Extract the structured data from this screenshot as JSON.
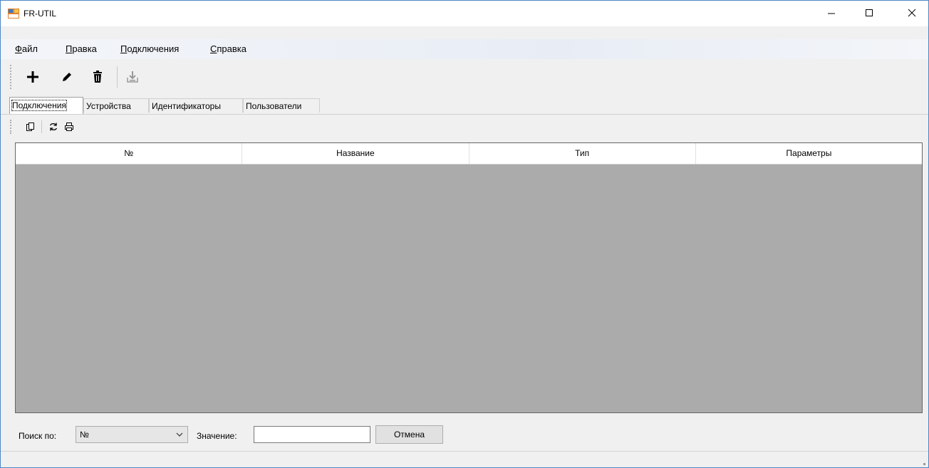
{
  "window": {
    "title": "FR-UTIL",
    "minimize_glyph": "–",
    "maximize_glyph": "☐",
    "close_glyph": "✕"
  },
  "menu": {
    "items": [
      {
        "label": "Файл"
      },
      {
        "label": "Правка"
      },
      {
        "label": "Подключения"
      },
      {
        "label": "Справка"
      }
    ]
  },
  "toolbar": {
    "icons": [
      "add-icon",
      "edit-pencil-icon",
      "delete-trash-icon",
      "import-download-icon"
    ]
  },
  "tabs": [
    {
      "label": "Подключения",
      "active": true
    },
    {
      "label": "Устройства",
      "active": false
    },
    {
      "label": "Идентификаторы",
      "active": false
    },
    {
      "label": "Пользователи",
      "active": false
    }
  ],
  "grid_toolbar": {
    "icons": [
      "copy-icon",
      "refresh-icon",
      "print-icon"
    ]
  },
  "grid": {
    "columns": [
      "№",
      "Название",
      "Тип",
      "Параметры"
    ],
    "rows": []
  },
  "search": {
    "by_label": "Поиск по:",
    "by_value": "№",
    "value_label": "Значение:",
    "value_text": "",
    "cancel_label": "Отмена"
  },
  "colors": {
    "grid_background": "#ababab",
    "window_border": "#4b88c6"
  }
}
